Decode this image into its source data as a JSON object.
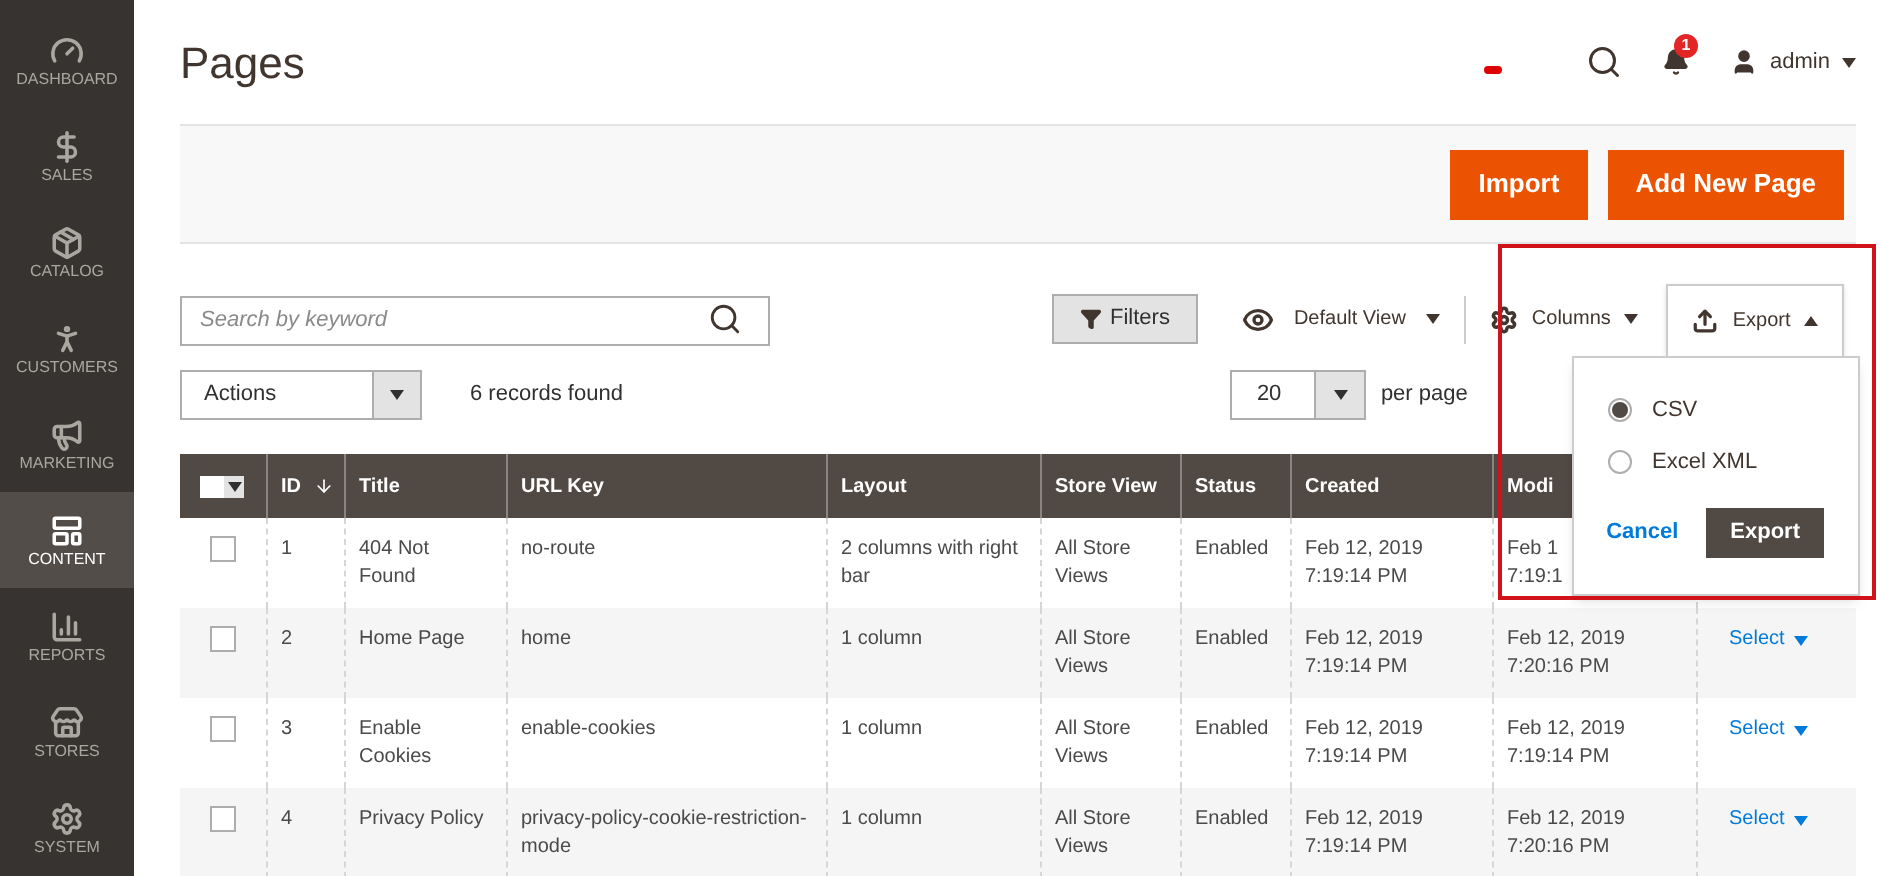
{
  "sidebar": {
    "items": [
      {
        "label": "DASHBOARD",
        "selected": false
      },
      {
        "label": "SALES",
        "selected": false
      },
      {
        "label": "CATALOG",
        "selected": false
      },
      {
        "label": "CUSTOMERS",
        "selected": false
      },
      {
        "label": "MARKETING",
        "selected": false
      },
      {
        "label": "CONTENT",
        "selected": true
      },
      {
        "label": "REPORTS",
        "selected": false
      },
      {
        "label": "STORES",
        "selected": false
      },
      {
        "label": "SYSTEM",
        "selected": false
      }
    ]
  },
  "header": {
    "title": "Pages",
    "notification_count": "1",
    "user": "admin"
  },
  "page_actions": [
    "Import",
    "Add New Page"
  ],
  "toolbar": {
    "search": {
      "placeholder": "Search by keyword"
    },
    "filters": "Filters",
    "view": "Default View",
    "columns": "Columns",
    "export": "Export",
    "export_open": true
  },
  "actions": "Actions",
  "records": "6 records found",
  "per_page": {
    "value": "20",
    "label": "per page"
  },
  "table": {
    "columns": [
      "ID",
      "Title",
      "URL Key",
      "Layout",
      "Store View",
      "Status",
      "Created",
      "Modi"
    ],
    "rows": [
      {
        "checked": false,
        "cells": [
          "1",
          "404 Not Found",
          "no-route",
          "2 columns with right bar",
          "All Store Views",
          "Enabled",
          "Feb 12, 2019 7:19:14 PM",
          "Feb 1\n7:19:1"
        ]
      },
      {
        "checked": false,
        "cells": [
          "2",
          "Home Page",
          "home",
          "1 column",
          "All Store Views",
          "Enabled",
          "Feb 12, 2019 7:19:14 PM",
          "Feb 12, 2019 7:20:16 PM"
        ],
        "action": "Select"
      },
      {
        "checked": false,
        "cells": [
          "3",
          "Enable Cookies",
          "enable-cookies",
          "1 column",
          "All Store Views",
          "Enabled",
          "Feb 12, 2019 7:19:14 PM",
          "Feb 12, 2019 7:19:14 PM"
        ],
        "action": "Select"
      },
      {
        "checked": false,
        "cells": [
          "4",
          "Privacy Policy",
          "privacy-policy-cookie-restriction-mode",
          "1 column",
          "All Store Views",
          "Enabled",
          "Feb 12, 2019 7:19:14 PM",
          "Feb 12, 2019 7:20:16 PM"
        ],
        "action": "Select"
      }
    ]
  },
  "export_menu": {
    "options": [
      {
        "label": "CSV",
        "selected": true
      },
      {
        "label": "Excel XML",
        "selected": false
      }
    ],
    "cancel": "Cancel",
    "submit": "Export"
  }
}
